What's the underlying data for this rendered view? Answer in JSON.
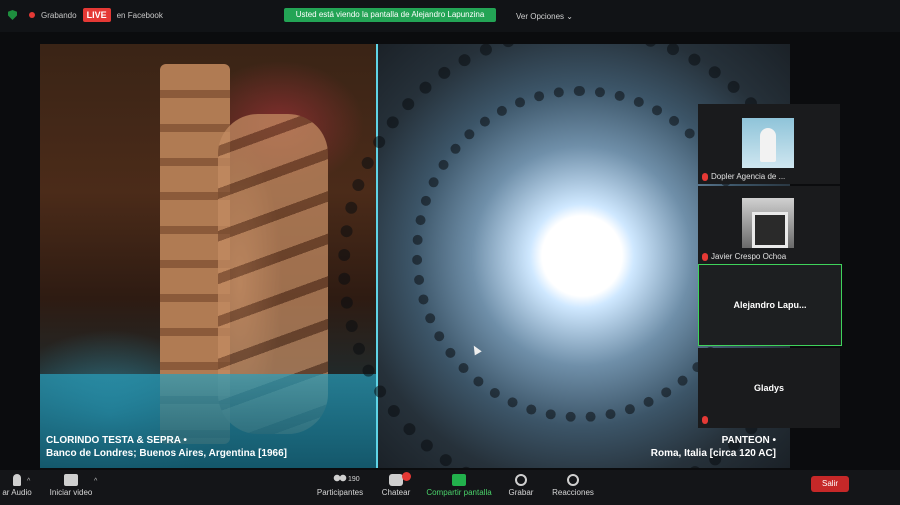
{
  "topbar": {
    "recording_text": "Grabando",
    "live_badge": "LIVE",
    "live_on": "en Facebook",
    "share_banner": "Usted está viendo la pantalla de Alejandro Lapunzina",
    "view_options": "Ver Opciones"
  },
  "slide": {
    "left_caption_line1": "CLORINDO TESTA & SEPRA •",
    "left_caption_line2": "Banco de Londres; Buenos Aires, Argentina [1966]",
    "right_caption_line1": "PANTEON •",
    "right_caption_line2": "Roma, Italia [circa 120 AC]"
  },
  "participants": [
    {
      "name": "Dopler Agencia de ..."
    },
    {
      "name": "Javier Crespo Ochoa"
    },
    {
      "name": "Alejandro  Lapu..."
    },
    {
      "name": "Gladys"
    }
  ],
  "toolbar": {
    "audio_label": "ar Audio",
    "video_label": "Iniciar video",
    "participants_label": "Participantes",
    "participants_count": "190",
    "chat_label": "Chatear",
    "share_label": "Compartir pantalla",
    "record_label": "Grabar",
    "reactions_label": "Reacciones",
    "leave_label": "Salir"
  },
  "colors": {
    "share_green": "#23a455",
    "live_red": "#e53935",
    "leave_red": "#c62828",
    "active_border": "#3fd35b"
  }
}
